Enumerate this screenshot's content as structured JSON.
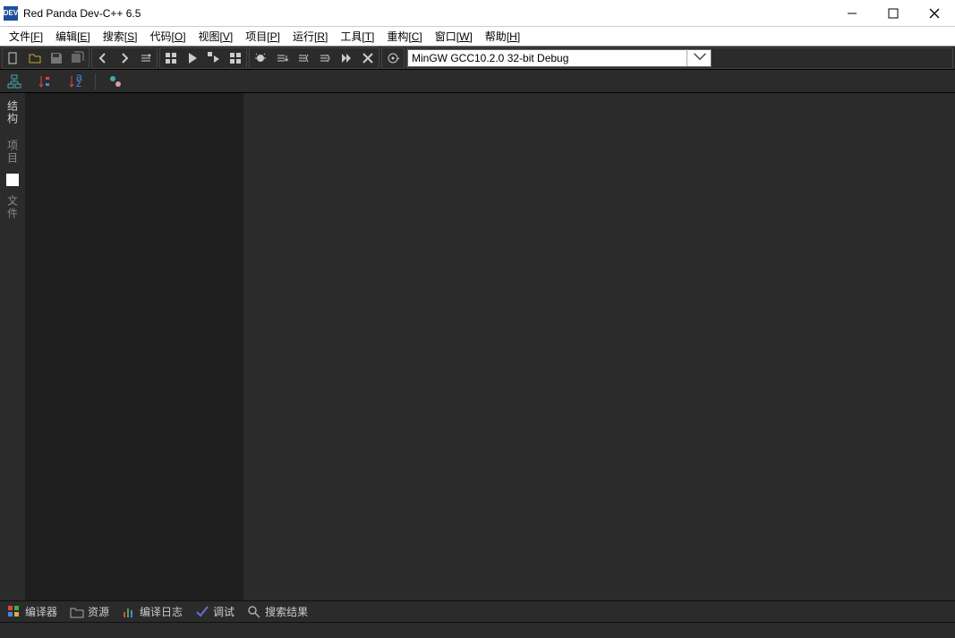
{
  "title": "Red Panda Dev-C++ 6.5",
  "app_icon_text": "DEV",
  "menu": [
    {
      "label": "文件",
      "hot": "F"
    },
    {
      "label": "编辑",
      "hot": "E"
    },
    {
      "label": "搜索",
      "hot": "S"
    },
    {
      "label": "代码",
      "hot": "O"
    },
    {
      "label": "视图",
      "hot": "V"
    },
    {
      "label": "项目",
      "hot": "P"
    },
    {
      "label": "运行",
      "hot": "R"
    },
    {
      "label": "工具",
      "hot": "T"
    },
    {
      "label": "重构",
      "hot": "C"
    },
    {
      "label": "窗口",
      "hot": "W"
    },
    {
      "label": "帮助",
      "hot": "H"
    }
  ],
  "compiler": "MinGW GCC10.2.0 32-bit Debug",
  "left_tabs": {
    "t0": "结构",
    "t1": "项目",
    "t2": "文件"
  },
  "bottom": {
    "compiler": "编译器",
    "resources": "资源",
    "compile_log": "编译日志",
    "debug": "调试",
    "search_results": "搜索结果"
  }
}
